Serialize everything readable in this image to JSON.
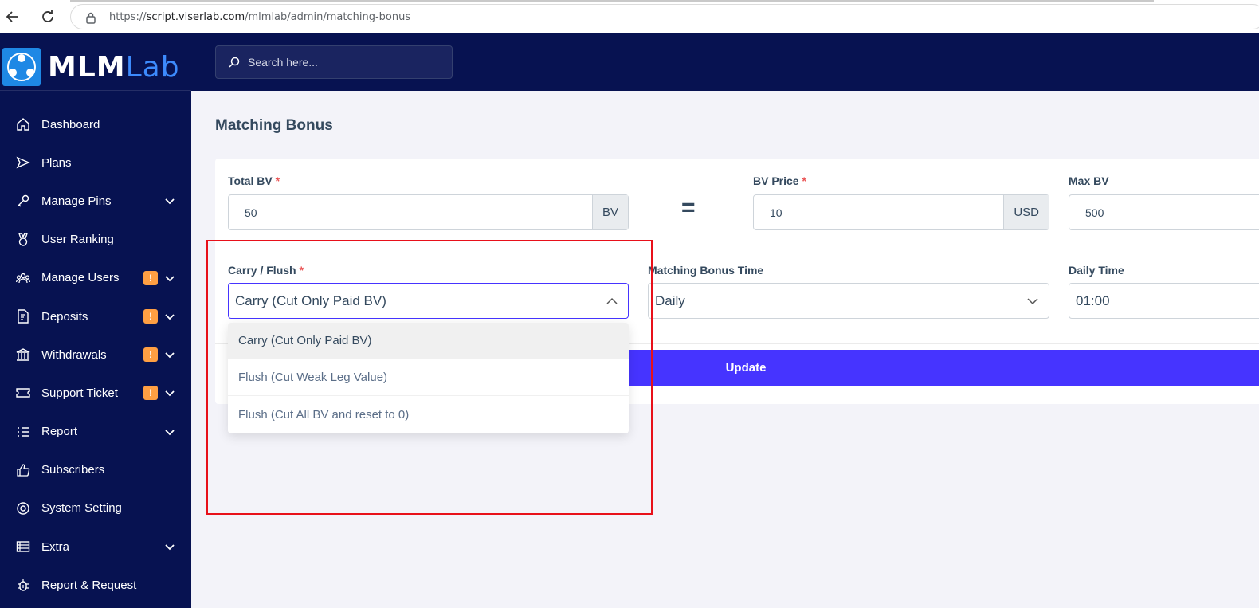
{
  "browser": {
    "url_scheme": "https://",
    "url_host": "script.viserlab.com",
    "url_path": "/mlmlab/admin/matching-bonus",
    "back_icon": "arrow-left-icon",
    "reload_icon": "reload-icon",
    "lock_icon": "lock-icon"
  },
  "brand": {
    "name_main": "MLM",
    "name_accent": "Lab",
    "accent_color": "#3d8bfd"
  },
  "sidebar": {
    "items": [
      {
        "label": "Dashboard",
        "icon": "home-icon",
        "badge": "",
        "has_chevron": false
      },
      {
        "label": "Plans",
        "icon": "send-icon",
        "badge": "",
        "has_chevron": false
      },
      {
        "label": "Manage Pins",
        "icon": "key-icon",
        "badge": "",
        "has_chevron": true
      },
      {
        "label": "User Ranking",
        "icon": "medal-icon",
        "badge": "",
        "has_chevron": false
      },
      {
        "label": "Manage Users",
        "icon": "users-icon",
        "badge": "!",
        "has_chevron": true
      },
      {
        "label": "Deposits",
        "icon": "file-dollar-icon",
        "badge": "!",
        "has_chevron": true
      },
      {
        "label": "Withdrawals",
        "icon": "bank-icon",
        "badge": "!",
        "has_chevron": true
      },
      {
        "label": "Support Ticket",
        "icon": "ticket-icon",
        "badge": "!",
        "has_chevron": true
      },
      {
        "label": "Report",
        "icon": "list-icon",
        "badge": "",
        "has_chevron": true
      },
      {
        "label": "Subscribers",
        "icon": "thumbs-up-icon",
        "badge": "",
        "has_chevron": false
      },
      {
        "label": "System Setting",
        "icon": "lifebuoy-icon",
        "badge": "",
        "has_chevron": false
      },
      {
        "label": "Extra",
        "icon": "server-icon",
        "badge": "",
        "has_chevron": true
      },
      {
        "label": "Report & Request",
        "icon": "bug-icon",
        "badge": "",
        "has_chevron": false
      }
    ]
  },
  "topbar": {
    "search_placeholder": "Search here..."
  },
  "page": {
    "title": "Matching Bonus"
  },
  "form": {
    "total_bv": {
      "label": "Total BV",
      "required": "*",
      "value": "50",
      "addon": "BV"
    },
    "equals": "=",
    "bv_price": {
      "label": "BV Price",
      "required": "*",
      "value": "10",
      "addon": "USD"
    },
    "max_bv": {
      "label": "Max BV",
      "value": "500"
    },
    "carry_flush": {
      "label": "Carry / Flush",
      "required": "*",
      "selected": "Carry (Cut Only Paid BV)",
      "options": [
        "Carry (Cut Only Paid BV)",
        "Flush (Cut Weak Leg Value)",
        "Flush (Cut All BV and reset to 0)"
      ]
    },
    "matching_time": {
      "label": "Matching Bonus Time",
      "selected": "Daily"
    },
    "daily_time": {
      "label": "Daily Time",
      "value": "01:00"
    },
    "submit_label": "Update"
  },
  "colors": {
    "sidebar_bg": "#071251",
    "primary": "#4634ff",
    "badge": "#ff9f43",
    "highlight": "#e8101a"
  }
}
